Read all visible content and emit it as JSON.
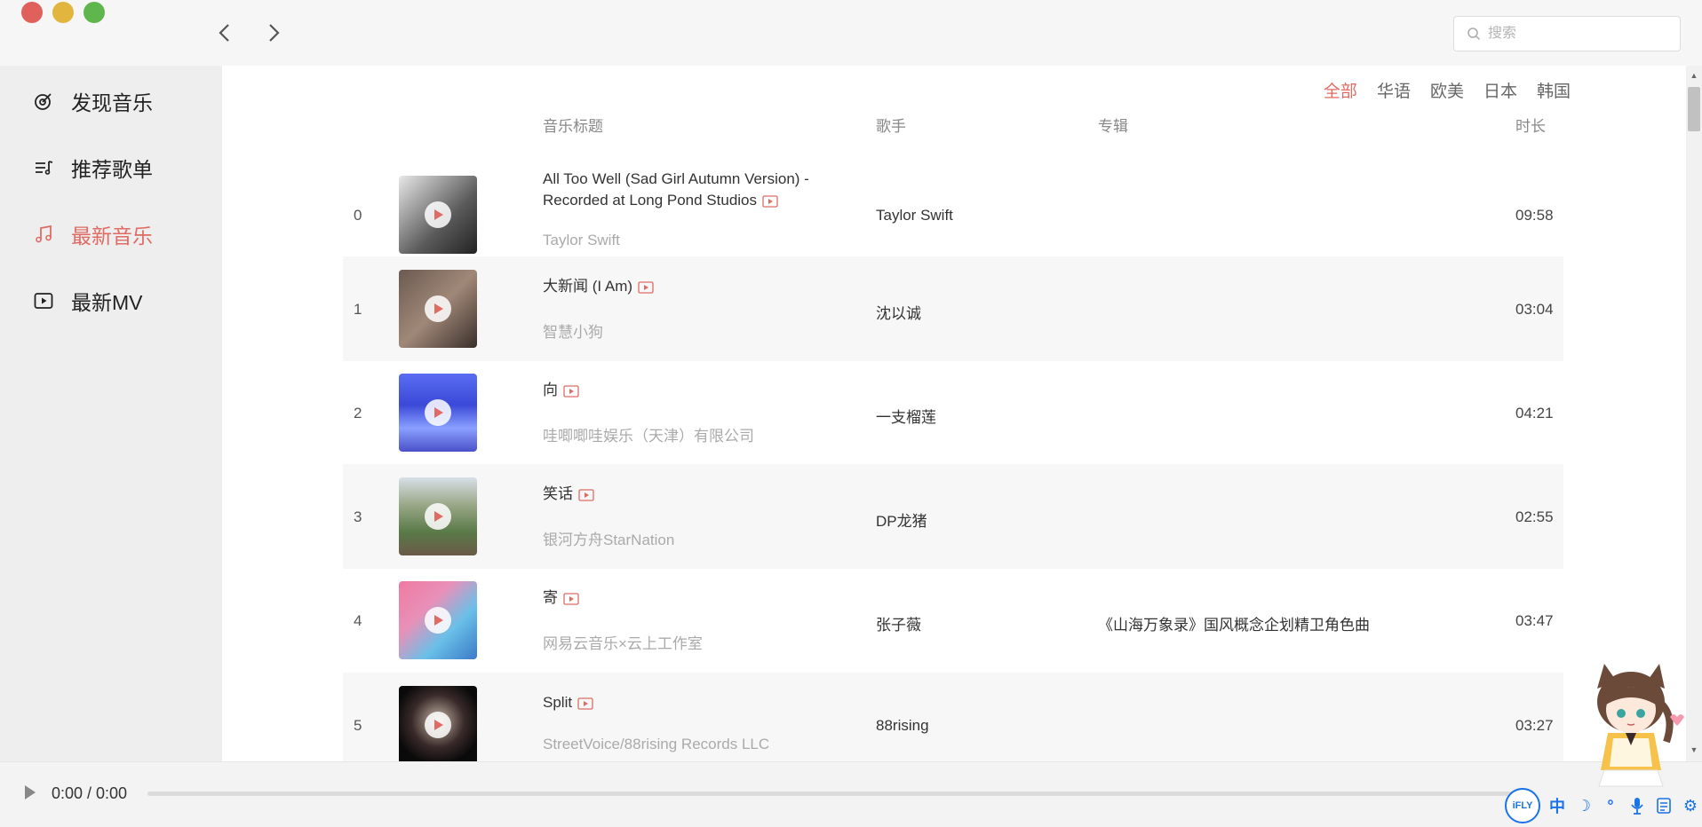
{
  "search": {
    "placeholder": "搜索"
  },
  "sidebar": {
    "items": [
      {
        "label": "发现音乐",
        "icon": "target-icon"
      },
      {
        "label": "推荐歌单",
        "icon": "playlist-icon"
      },
      {
        "label": "最新音乐",
        "icon": "music-note-icon",
        "active": true
      },
      {
        "label": "最新MV",
        "icon": "video-play-icon"
      }
    ]
  },
  "filters": {
    "items": [
      "全部",
      "华语",
      "欧美",
      "日本",
      "韩国"
    ],
    "active": "全部"
  },
  "columns": {
    "title": "音乐标题",
    "artist": "歌手",
    "album": "专辑",
    "duration": "时长"
  },
  "songs": [
    {
      "index": "0",
      "title": "All Too Well (Sad Girl Autumn Version) - Recorded at Long Pond Studios",
      "subtitle": "Taylor Swift",
      "artist": "Taylor Swift",
      "album": "",
      "duration": "09:58"
    },
    {
      "index": "1",
      "title": "大新闻 (I Am)",
      "subtitle": "智慧小狗",
      "artist": "沈以诚",
      "album": "",
      "duration": "03:04"
    },
    {
      "index": "2",
      "title": "向",
      "subtitle": "哇唧唧哇娱乐（天津）有限公司",
      "artist": "一支榴莲",
      "album": "",
      "duration": "04:21"
    },
    {
      "index": "3",
      "title": "笑话",
      "subtitle": "银河方舟StarNation",
      "artist": "DP龙猪",
      "album": "",
      "duration": "02:55"
    },
    {
      "index": "4",
      "title": "寄",
      "subtitle": "网易云音乐×云上工作室",
      "artist": "张子薇",
      "album": "《山海万象录》国风概念企划精卫角色曲",
      "duration": "03:47"
    },
    {
      "index": "5",
      "title": "Split",
      "subtitle": "StreetVoice/88rising Records LLC",
      "artist": "88rising",
      "album": "",
      "duration": "03:27"
    }
  ],
  "player": {
    "time": "0:00 / 0:00",
    "progress": 0
  },
  "ime": {
    "logo": "iFLY",
    "mode": "中"
  },
  "colors": {
    "accent": "#e06b63",
    "sidebar_bg": "#eeeeee",
    "row_alt": "#f7f7f7"
  }
}
